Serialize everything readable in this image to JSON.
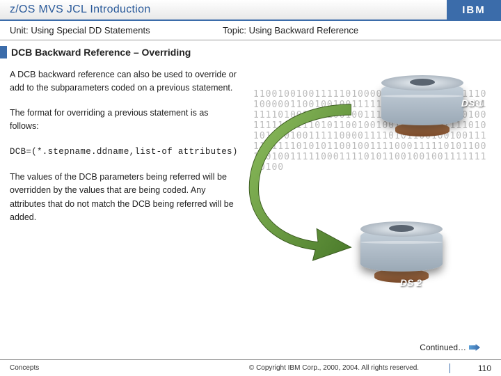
{
  "header": {
    "course_title": "z/OS MVS JCL Introduction",
    "logo_text": "IBM",
    "unit": "Unit: Using Special DD Statements",
    "topic": "Topic: Using Backward Reference"
  },
  "section_heading": "DCB Backward Reference – Overriding",
  "body": {
    "p1": "A DCB backward reference can also be used to override or add to the subparameters coded on a previous statement.",
    "p2": "The format for overriding a previous statement is as follows:",
    "code": "DCB=(*.stepname.ddname,list-of attributes)",
    "p3": "The values of the DCB parameters being referred will be overridden by the values that are being coded. Any attributes that do not match the DCB being referred will be added."
  },
  "illustration": {
    "disk1_label": "DS 1",
    "disk2_label": "DS 2",
    "binary_fill": "1100100100111110100000110010010011111010000011001001001111101011111001001001111101001100100100111110100001001001001111100111010110010010011111001111101010110010011111000011110101100100100111110111101010110010011110001111101011001001001111100011110101100100100111111100100"
  },
  "continued": "Continued…",
  "footer": {
    "left": "Concepts",
    "center": "© Copyright IBM Corp., 2000, 2004. All rights reserved.",
    "page": "110"
  }
}
